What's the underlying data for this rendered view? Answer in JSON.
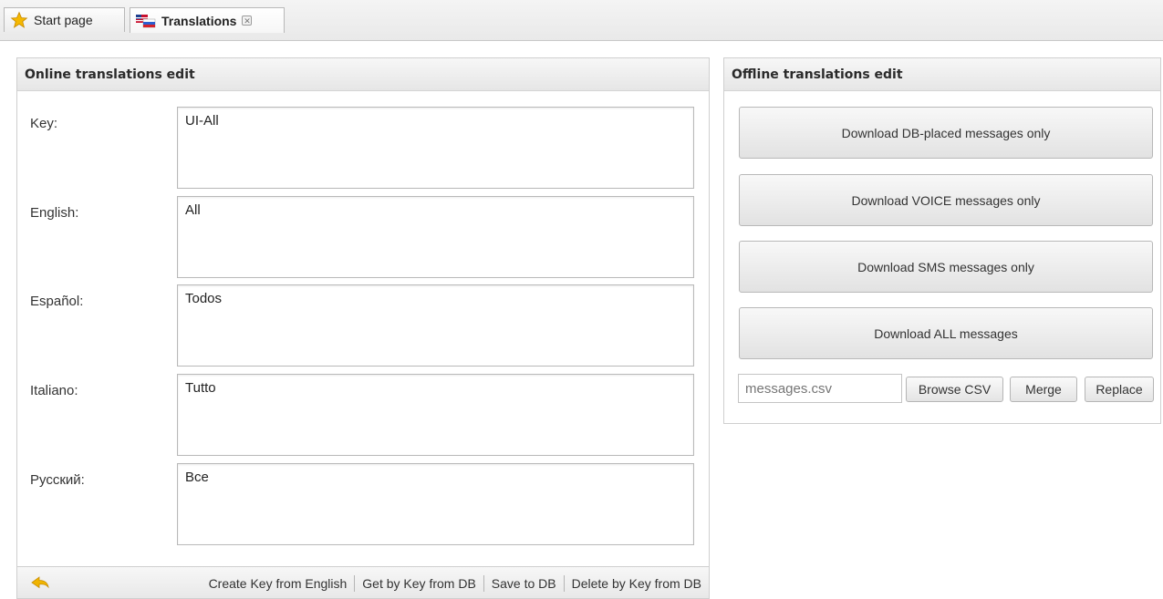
{
  "tabs": [
    {
      "label": "Start page"
    },
    {
      "label": "Translations",
      "close": "✕"
    }
  ],
  "online": {
    "title": "Online translations edit",
    "fields": [
      {
        "label": "Key:",
        "value": "UI-All"
      },
      {
        "label": "English:",
        "value": "All"
      },
      {
        "label": "Español:",
        "value": "Todos"
      },
      {
        "label": "Italiano:",
        "value": "Tutto"
      },
      {
        "label": "Русский:",
        "value": "Все"
      }
    ],
    "footer": {
      "create": "Create Key from English",
      "get": "Get by Key from DB",
      "save": "Save to DB",
      "delete": "Delete by Key from DB"
    }
  },
  "offline": {
    "title": "Offline translations edit",
    "buttons": [
      {
        "label": "Download DB-placed messages only"
      },
      {
        "label": "Download VOICE messages only"
      },
      {
        "label": "Download SMS messages only"
      },
      {
        "label": "Download ALL messages"
      }
    ],
    "csv": {
      "placeholder": "messages.csv",
      "browse": "Browse CSV",
      "merge": "Merge",
      "replace": "Replace"
    }
  },
  "colors": {
    "star": "#f5b800",
    "undo_arrow": "#f0b400"
  }
}
